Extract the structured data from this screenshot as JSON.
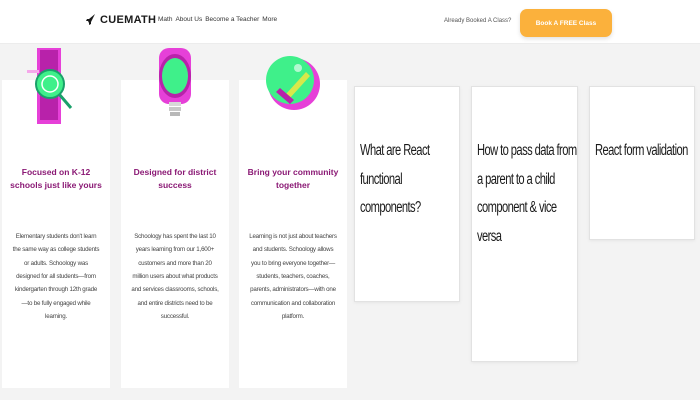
{
  "navbar": {
    "brand": "CUEMATH",
    "links": [
      "Math",
      "About Us",
      "Become a Teacher",
      "More"
    ],
    "already_booked": "Already Booked A Class?",
    "cta_label": "Book A FREE Class",
    "accent_color": "#fbb13c"
  },
  "features": [
    {
      "icon": "school-magnifier-icon",
      "title": "Focused on K-12 schools just like yours",
      "body": "Elementary students don't learn the same way as college students or adults. Schoology was designed for all students—from kindergarten through 12th grade—to be fully engaged while learning."
    },
    {
      "icon": "lightbulb-icon",
      "title": "Designed for district success",
      "body": "Schoology has spent the last 10 years learning from our 1,600+ customers and more than 20 million users about what products and services classrooms, schools, and entire districts need to be successful."
    },
    {
      "icon": "community-badge-icon",
      "title": "Bring your community together",
      "body": "Learning is not just about teachers and students. Schoology allows you to bring everyone together—students, teachers, coaches, parents, administrators—with one communication and collaboration platform."
    }
  ],
  "question_cards": [
    {
      "text": "What are React functional components?"
    },
    {
      "text": "How to pass data from a parent to a child component & vice versa"
    },
    {
      "text": "React form validation"
    }
  ],
  "colors": {
    "title_purple": "#8a1874",
    "green_blob": "#3ff08a",
    "pink_frame": "#e640d8"
  }
}
